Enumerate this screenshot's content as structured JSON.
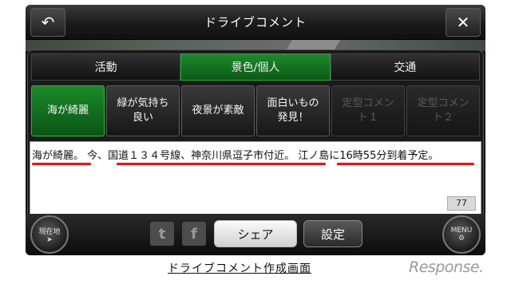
{
  "header": {
    "title": "ドライブコメント",
    "back_icon": "back-arrow-icon",
    "close_icon": "close-icon"
  },
  "tabs": [
    {
      "label": "活動",
      "active": false
    },
    {
      "label": "景色/個人",
      "active": true
    },
    {
      "label": "交通",
      "active": false
    }
  ],
  "comment_buttons": [
    {
      "label": "海が綺麗",
      "state": "active"
    },
    {
      "label": "緑が気持ち\n良い",
      "state": "normal"
    },
    {
      "label": "夜景が素敵",
      "state": "normal"
    },
    {
      "label": "面白いもの\n発見！",
      "state": "normal"
    },
    {
      "label": "定型コメン\nト１",
      "state": "disabled"
    },
    {
      "label": "定型コメン\nト２",
      "state": "disabled"
    }
  ],
  "comment": {
    "text": "海が綺麗。 今、国道１３４号線、神奈川県逗子市付近。 江ノ島に16時55分到着予定。",
    "char_count": "77",
    "underline_color": "#d81b1b"
  },
  "bottom_bar": {
    "left_round_label": "現在地",
    "right_round_label": "MENU",
    "twitter_glyph": "t",
    "facebook_glyph": "f",
    "share_label": "シェア",
    "settings_label": "設定"
  },
  "caption": "ドライブコメント作成画面",
  "watermark": "Response.",
  "colors": {
    "accent_green": "#1b8a28",
    "underline_red": "#d81b1b"
  }
}
